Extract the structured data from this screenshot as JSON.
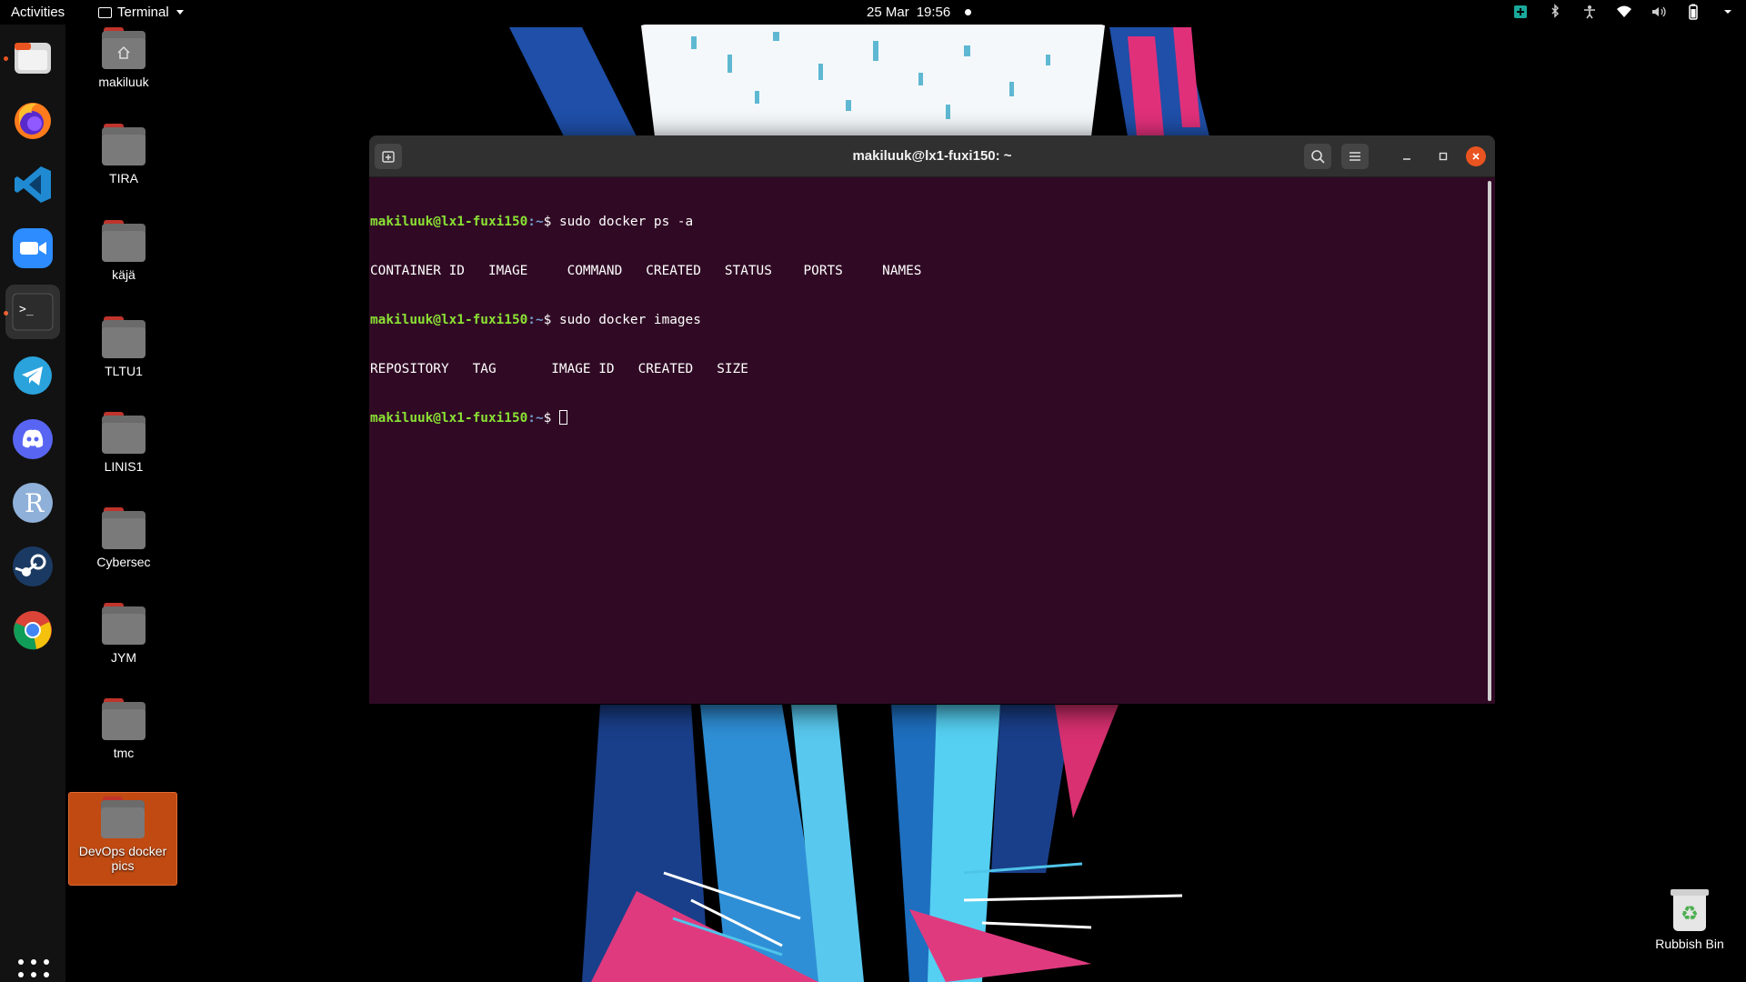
{
  "topbar": {
    "activities": "Activities",
    "app_name": "Terminal",
    "date": "25 Mar",
    "time": "19:56"
  },
  "dock": {
    "apps": [
      {
        "name": "Files",
        "icon": "files-icon"
      },
      {
        "name": "Firefox",
        "icon": "firefox-icon"
      },
      {
        "name": "Visual Studio Code",
        "icon": "vscode-icon"
      },
      {
        "name": "Zoom",
        "icon": "zoom-icon"
      },
      {
        "name": "Terminal",
        "icon": "terminal-icon"
      },
      {
        "name": "Telegram",
        "icon": "telegram-icon"
      },
      {
        "name": "Discord",
        "icon": "discord-icon"
      },
      {
        "name": "R",
        "icon": "r-icon",
        "glyph": "R"
      },
      {
        "name": "Steam",
        "icon": "steam-icon"
      },
      {
        "name": "Chrome",
        "icon": "chrome-icon"
      }
    ],
    "terminal_glyph": ">_"
  },
  "desktop": {
    "icons": [
      {
        "label": "makiluuk",
        "type": "home-folder"
      },
      {
        "label": "TIRA",
        "type": "folder"
      },
      {
        "label": "käjä",
        "type": "folder"
      },
      {
        "label": "TLTU1",
        "type": "folder"
      },
      {
        "label": "LINIS1",
        "type": "folder"
      },
      {
        "label": "Cybersec",
        "type": "folder"
      },
      {
        "label": "JYM",
        "type": "folder"
      },
      {
        "label": "tmc",
        "type": "folder"
      },
      {
        "label": "DevOps docker pics",
        "type": "folder",
        "selected": true
      }
    ],
    "rubbish_bin": "Rubbish Bin"
  },
  "terminal": {
    "title": "makiluuk@lx1-fuxi150: ~",
    "prompt_user": "makiluuk@lx1-fuxi150",
    "prompt_path": ":~",
    "prompt_symbol": "$ ",
    "lines": [
      {
        "type": "command",
        "text": "sudo docker ps -a"
      },
      {
        "type": "output",
        "text": "CONTAINER ID   IMAGE     COMMAND   CREATED   STATUS    PORTS     NAMES"
      },
      {
        "type": "command",
        "text": "sudo docker images"
      },
      {
        "type": "output",
        "text": "REPOSITORY   TAG       IMAGE ID   CREATED   SIZE"
      },
      {
        "type": "prompt",
        "text": ""
      }
    ]
  },
  "colors": {
    "terminal_bg": "#300a24",
    "prompt_user": "#8ae234",
    "prompt_path": "#729fcf",
    "accent": "#e95420",
    "selected_icon_bg": "#c04a12"
  }
}
